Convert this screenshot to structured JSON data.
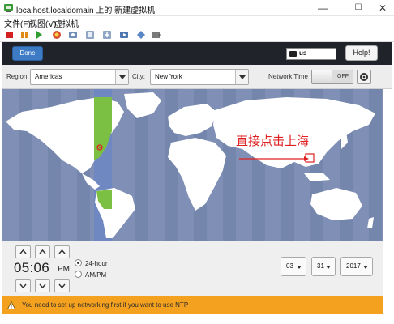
{
  "window": {
    "title": "localhost.localdomain 上的 新建虚拟机",
    "minimize": "—",
    "maximize": "☐",
    "close": "✕"
  },
  "menu": {
    "items": [
      "文件(F)",
      "视图(V)",
      "虚拟机"
    ]
  },
  "toolbar": {
    "icons": [
      "stop-icon",
      "pause-icon",
      "play-icon",
      "restart-icon",
      "snapshot-icon",
      "snapshot-manager-icon",
      "snapshot-revert-icon",
      "send-keys-icon",
      "fullscreen-icon",
      "console-icon"
    ]
  },
  "header": {
    "done_label": "Done",
    "keyboard_layout": "us",
    "help_label": "Help!"
  },
  "selectors": {
    "region_label": "Region:",
    "region_value": "Americas",
    "city_label": "City:",
    "city_value": "New York",
    "network_time_label": "Network Time",
    "network_time_state": "OFF"
  },
  "map": {
    "annotation": "直接点击上海",
    "colors": {
      "ocean": "#7f8fb5",
      "land": "#ffffff",
      "highlight": "#7bc043",
      "marker": "#e02020"
    }
  },
  "time": {
    "value": "05:06",
    "meridiem": "PM",
    "format_24": "24-hour",
    "format_ampm": "AM/PM",
    "selected_format": "24-hour"
  },
  "date": {
    "month": "03",
    "day": "31",
    "year": "2017"
  },
  "warning": {
    "text": "You need to set up networking first if you want to use NTP"
  }
}
